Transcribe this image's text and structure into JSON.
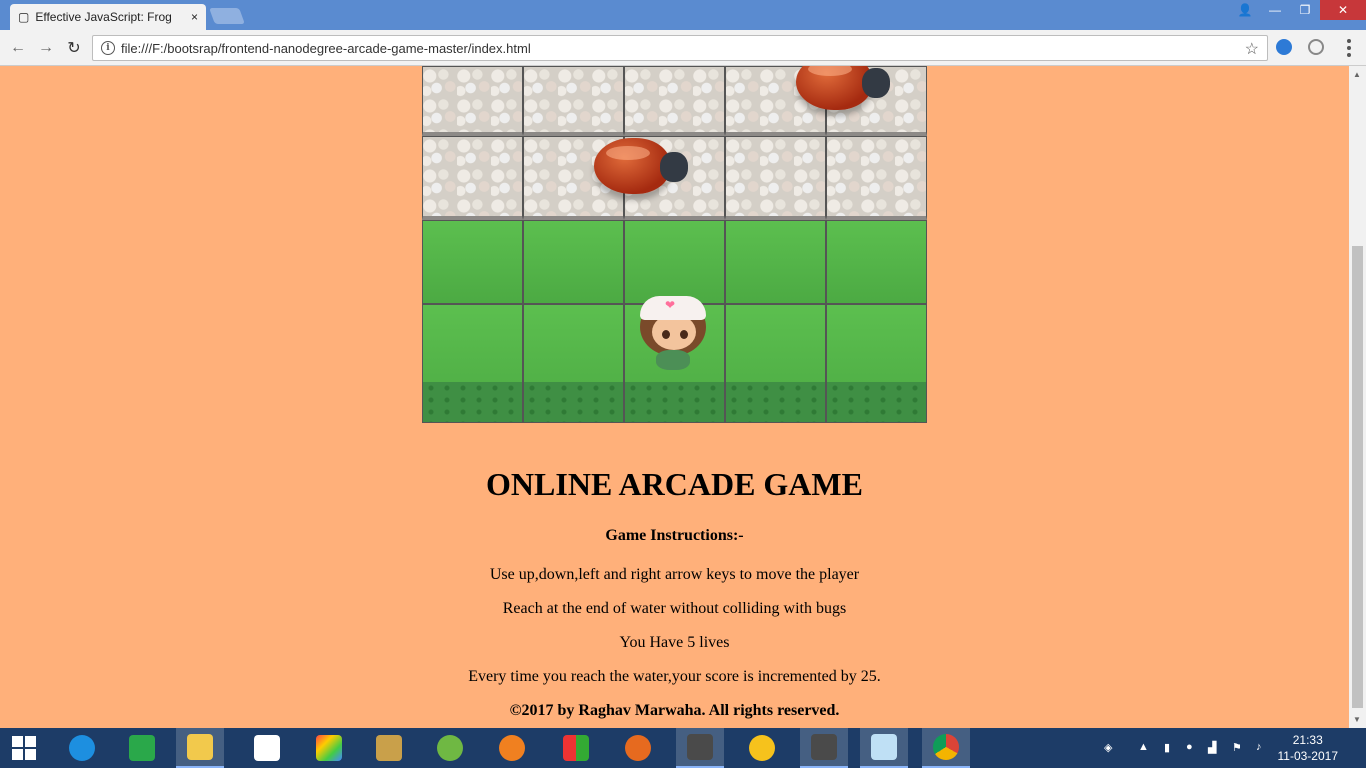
{
  "browser": {
    "tab_title": "Effective JavaScript: Frog",
    "close_label": "×",
    "url": "file:///F:/bootsrap/frontend-nanodegree-arcade-game-master/index.html",
    "info_icon": "i",
    "back": "←",
    "forward": "→",
    "reload": "↻",
    "star": "☆"
  },
  "page": {
    "heading": "ONLINE ARCADE GAME",
    "instructions_title": "Game Instructions:-",
    "lines": [
      "Use up,down,left and right arrow keys to move the player",
      "Reach at the end of water without colliding with bugs",
      "You Have 5 lives",
      "Every time you reach the water,your score is incremented by 25."
    ],
    "copyright": "©2017 by Raghav Marwaha. All rights reserved."
  },
  "taskbar": {
    "time": "21:33",
    "date": "11-03-2017"
  },
  "colors": {
    "page_bg": "#ffb07a",
    "tabstrip": "#5a8bd0",
    "taskbar": "#1d3c67"
  }
}
